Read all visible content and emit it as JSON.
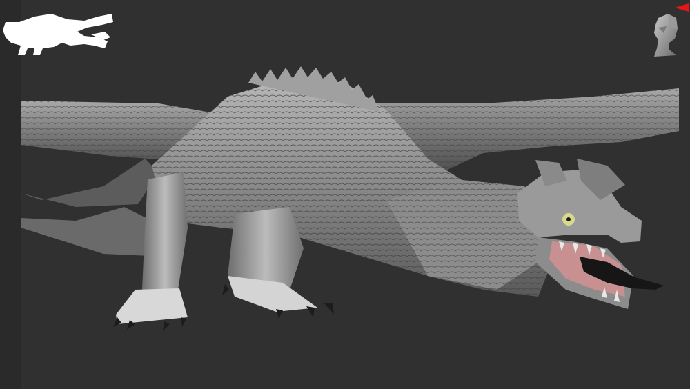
{
  "viewport": {
    "background_color": "#303030",
    "left_strip_color": "#2a2a2a"
  },
  "silhouette_preview": {
    "icon": "dragon-silhouette-icon",
    "color": "#ffffff"
  },
  "navigation": {
    "head_icon": "navigation-head-icon",
    "axis_icon": "axis-marker-icon",
    "axis_color": "#e01818"
  },
  "model": {
    "icon": "dragon-sculpt",
    "material_color": "#9a9a9a",
    "mouth_color": "#c89090",
    "eye_color": "#d8d890"
  }
}
